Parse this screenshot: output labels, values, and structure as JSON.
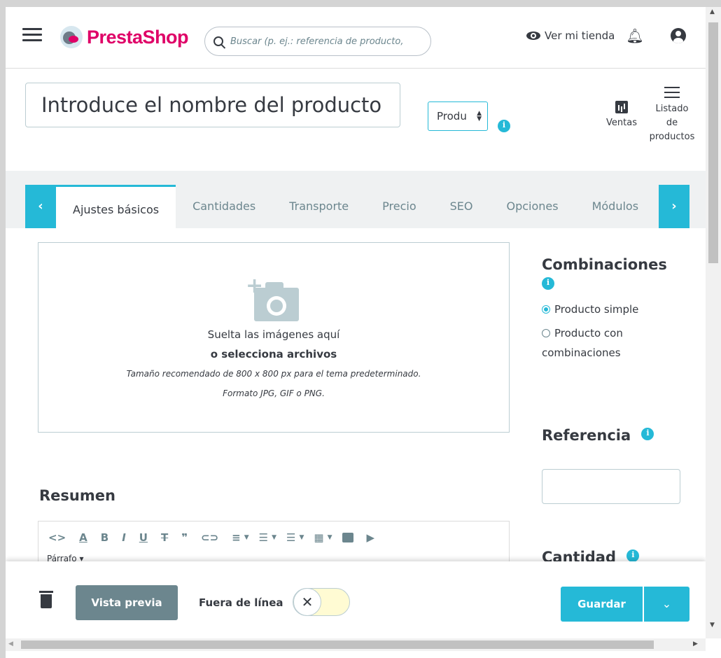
{
  "topbar": {
    "logo_text": "PrestaShop",
    "search_placeholder": "Buscar (p. ej.: referencia de producto,",
    "view_store": "Ver mi tienda",
    "icons": {
      "menu": "hamburger-icon",
      "search": "search-icon",
      "eye": "eye-icon",
      "bell": "bell-icon",
      "user": "user-icon"
    }
  },
  "header": {
    "name_placeholder": "Introduce el nombre del producto",
    "product_type": "Produ",
    "ventas_label": "Ventas",
    "listado_label": [
      "Listado",
      "de",
      "productos"
    ]
  },
  "tabs": {
    "items": [
      "Ajustes básicos",
      "Cantidades",
      "Transporte",
      "Precio",
      "SEO",
      "Opciones",
      "Módulos"
    ],
    "active": "Ajustes básicos",
    "prev_arrow": "‹",
    "next_arrow": "›"
  },
  "dropzone": {
    "line1": "Suelta las imágenes aquí",
    "line2": "o selecciona archivos",
    "line3": "Tamaño recomendado de 800 x 800 px para el tema predeterminado.",
    "line4": "Formato JPG, GIF o PNG."
  },
  "summary": {
    "title": "Resumen",
    "paragraph_select": "Párrafo ▾"
  },
  "combinations": {
    "title": "Combinaciones",
    "option_simple": "Producto simple",
    "option_combinations_line1": "Producto con",
    "option_combinations_line2": "combinaciones",
    "selected": "Producto simple"
  },
  "reference": {
    "title": "Referencia",
    "value": ""
  },
  "quantity": {
    "title": "Cantidad"
  },
  "footer": {
    "preview_label": "Vista previa",
    "offline_label": "Fuera de línea",
    "toggle_symbol": "✕",
    "save_label": "Guardar",
    "save_dropdown": "⌄"
  },
  "colors": {
    "accent": "#25b9d7",
    "brand": "#df0067",
    "text": "#363a41",
    "muted": "#6c868e"
  }
}
